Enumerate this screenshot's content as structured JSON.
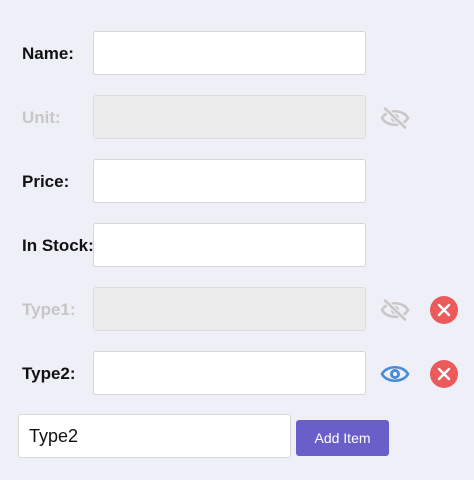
{
  "colors": {
    "background": "#efeff8",
    "disabled_text": "#c6c6c6",
    "eye_active": "#4b8ad8",
    "eye_hidden": "#c8c8c8",
    "remove": "#ec5b5b",
    "button": "#6a5fc9"
  },
  "fields": [
    {
      "label": "Name:",
      "value": "",
      "disabled": false
    },
    {
      "label": "Unit:",
      "value": "",
      "disabled": true,
      "visibility_icon": "eye-slash-icon"
    },
    {
      "label": "Price:",
      "value": "",
      "disabled": false
    },
    {
      "label": "In Stock:",
      "value": "",
      "disabled": false
    },
    {
      "label": "Type1:",
      "value": "",
      "disabled": true,
      "visibility_icon": "eye-slash-icon",
      "remove_icon": "close-icon"
    },
    {
      "label": "Type2:",
      "value": "",
      "disabled": false,
      "visibility_icon": "eye-icon",
      "remove_icon": "close-icon"
    }
  ],
  "new_field": {
    "value": "Type2",
    "button_label": "Add Item"
  }
}
